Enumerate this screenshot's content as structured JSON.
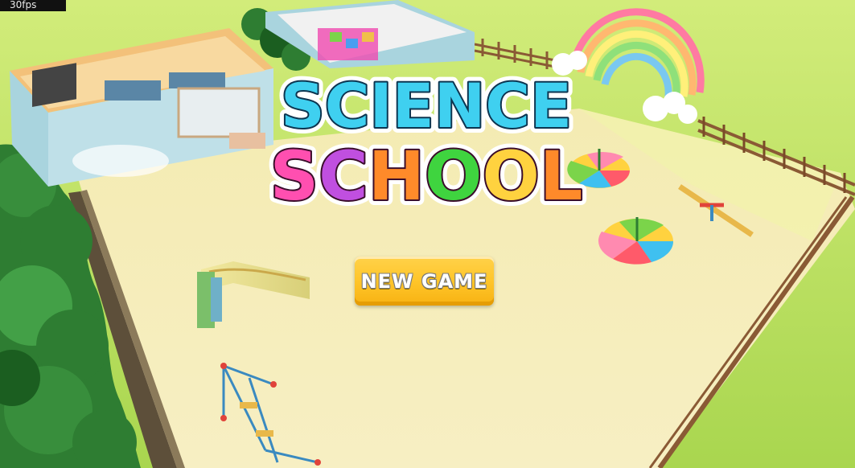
{
  "hud": {
    "fps": "30fps"
  },
  "title": {
    "line1": "SCIENCE",
    "line2": "SCHOOL"
  },
  "menu": {
    "new_game_label": "NEW GAME"
  },
  "colors": {
    "grass": "#bfe36a",
    "sand": "#f6edb8",
    "fence": "#8a5a35",
    "science_fill": "#3fd0f0",
    "school_letters": [
      "#ff4fb0",
      "#c04fe0",
      "#ff8a2a",
      "#3fd43f",
      "#ffd23f",
      "#ff8a2a"
    ],
    "button": "#ffc52a"
  }
}
